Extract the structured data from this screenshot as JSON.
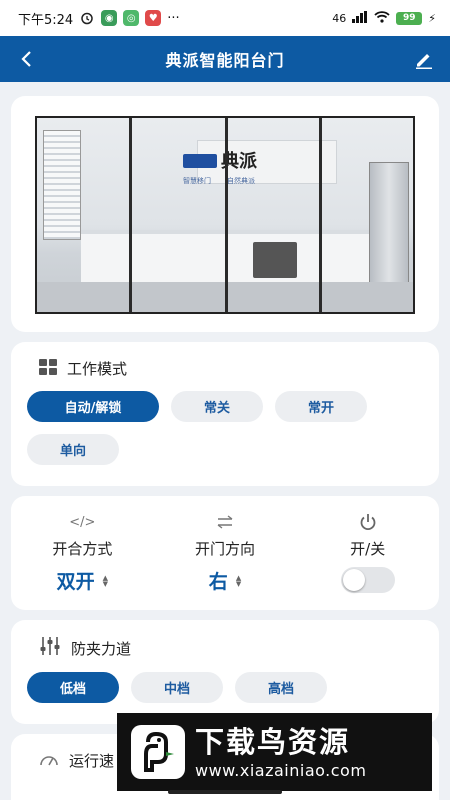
{
  "status_bar": {
    "time": "下午5:24",
    "network": "46",
    "battery": "99"
  },
  "app_bar": {
    "title": "典派智能阳台门",
    "back_icon": "back-arrow-icon",
    "edit_icon": "pencil-icon"
  },
  "hero": {
    "logo_text": "典派",
    "logo_sub_left": "智慧移门",
    "logo_sub_right": "自然典派"
  },
  "work_mode": {
    "title": "工作模式",
    "options": [
      "自动/解锁",
      "常关",
      "常开",
      "单向"
    ],
    "selected": "自动/解锁"
  },
  "controls": {
    "open_mode": {
      "label": "开合方式",
      "value": "双开",
      "icon": "code-icon"
    },
    "direction": {
      "label": "开门方向",
      "value": "右",
      "icon": "swap-icon"
    },
    "power": {
      "label": "开/关",
      "icon": "power-icon",
      "on": false
    }
  },
  "anti_pinch": {
    "title": "防夹力道",
    "options": [
      "低档",
      "中档",
      "高档"
    ],
    "selected": "低档"
  },
  "run_speed": {
    "title": "运行速"
  },
  "ad": {
    "title": "下载鸟资源",
    "url": "www.xiazainiao.com"
  },
  "colors": {
    "primary": "#0d5aa3",
    "chip_bg": "#eceef1",
    "page_bg": "#eef1f5"
  }
}
